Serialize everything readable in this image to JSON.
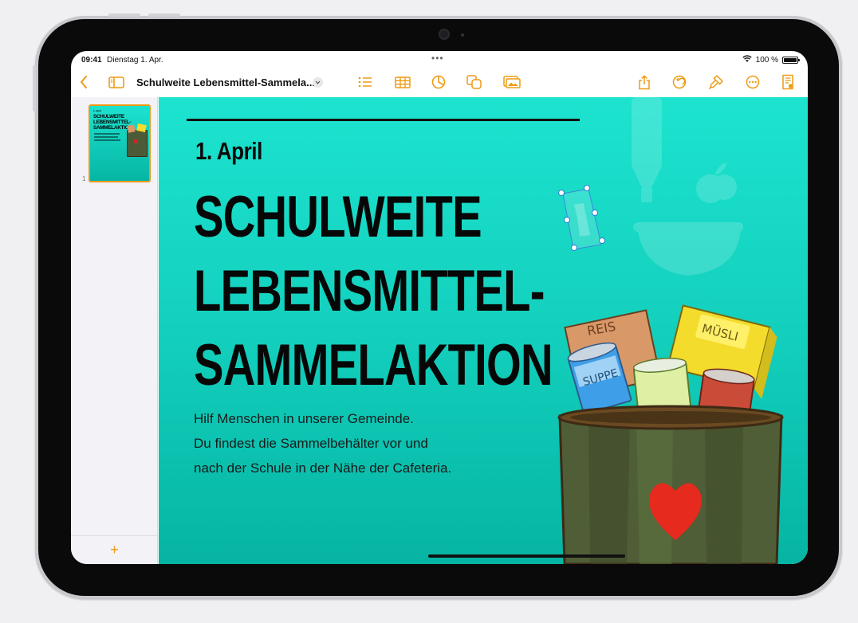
{
  "status_bar": {
    "time": "09:41",
    "date": "Dienstag 1. Apr.",
    "battery": "100 %",
    "battery_level": 1.0
  },
  "toolbar": {
    "document_title": "Schulweite Lebensmittel-Sammela...",
    "icons": [
      "back-chevron",
      "sidebar-toggle",
      "title-menu-chevron",
      "list-format",
      "table",
      "chart",
      "shapes",
      "media",
      "share",
      "undo",
      "format-brush",
      "more",
      "document-setup"
    ]
  },
  "sidebar": {
    "pages": [
      {
        "number": "1",
        "thumb_date": "1. April",
        "thumb_title": [
          "SCHULWEITE",
          "LEBENSMITTEL-",
          "SAMMELAKTION"
        ]
      }
    ],
    "add_label": "+"
  },
  "page": {
    "date": "1. April",
    "headline": [
      "SCHULWEITE",
      "LEBENSMITTEL-",
      "SAMMELAKTION"
    ],
    "body": [
      "Hilf Menschen in unserer Gemeinde.",
      "Du findest die Sammelbehälter vor und",
      "nach der Schule in der Nähe der Cafeteria."
    ],
    "illustration": {
      "box_labels": [
        "REIS",
        "MÜSLI",
        "SUPPE"
      ]
    }
  },
  "colors": {
    "accent": "#ee9a14",
    "canvas_top": "#1ce3cf",
    "canvas_bottom": "#06b4a3",
    "text": "#070707"
  }
}
